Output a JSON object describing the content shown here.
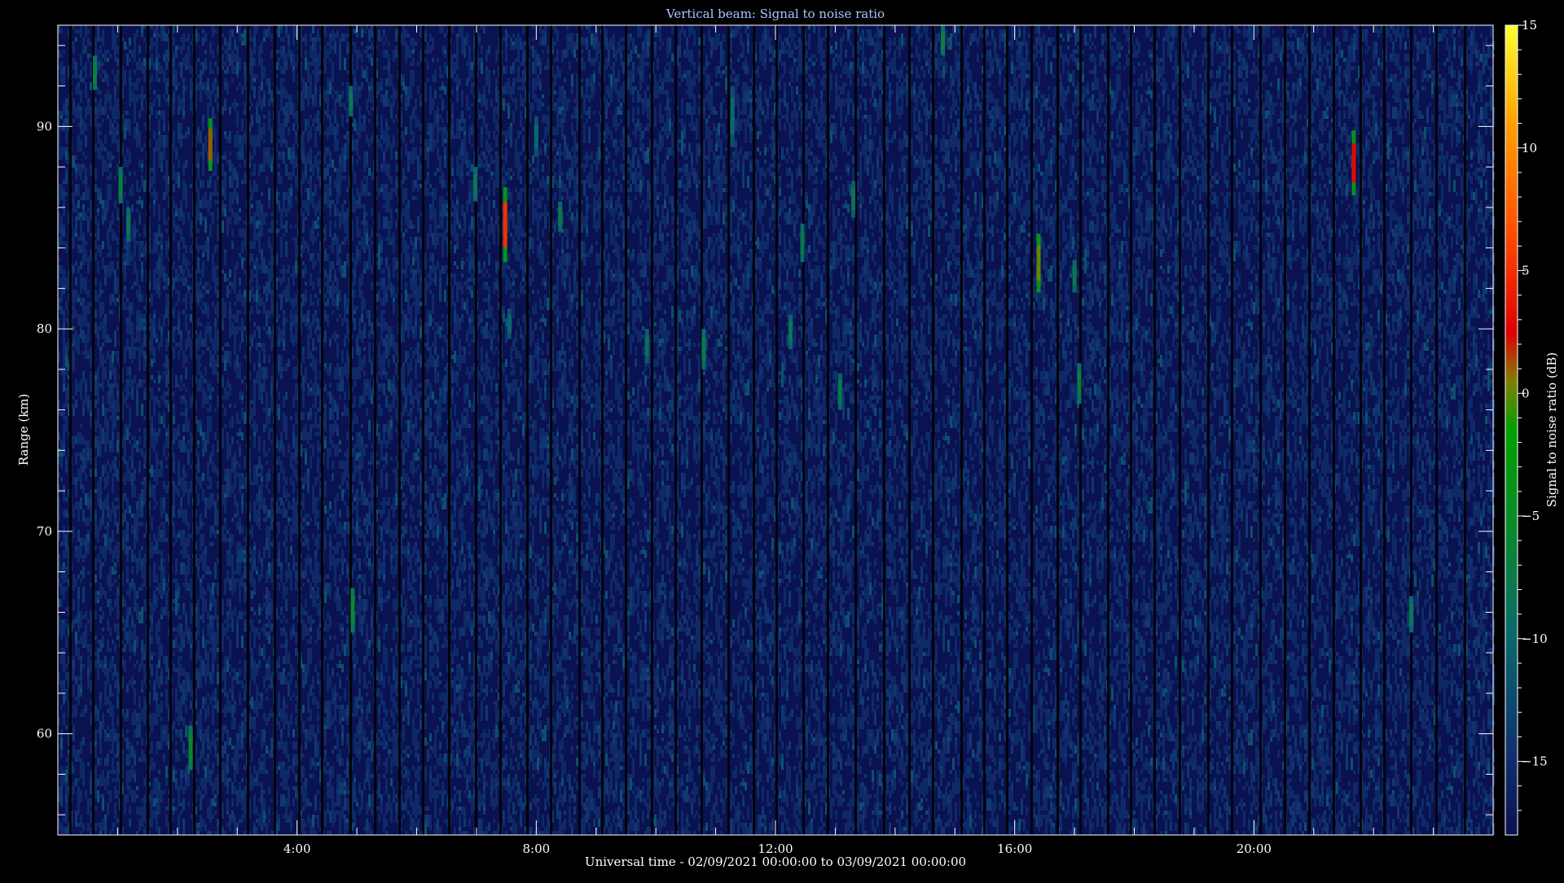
{
  "chart_data": {
    "type": "heatmap",
    "title": "Vertical beam: Signal to noise ratio",
    "xlabel": "Universal time - 02/09/2021 00:00:00 to 03/09/2021 00:00:00",
    "ylabel": "Range (km)",
    "colorbar_label": "Signal to noise ratio (dB)",
    "xlim": [
      0,
      24
    ],
    "ylim": [
      55,
      95
    ],
    "x_ticks": [
      {
        "value": 4,
        "label": "4:00"
      },
      {
        "value": 8,
        "label": "8:00"
      },
      {
        "value": 12,
        "label": "12:00"
      },
      {
        "value": 16,
        "label": "16:00"
      },
      {
        "value": 20,
        "label": "20:00"
      }
    ],
    "y_ticks": [
      {
        "value": 60,
        "label": "60"
      },
      {
        "value": 70,
        "label": "70"
      },
      {
        "value": 80,
        "label": "80"
      },
      {
        "value": 90,
        "label": "90"
      }
    ],
    "colorbar_range": [
      -18,
      15
    ],
    "colorbar_ticks": [
      {
        "value": 15,
        "label": "15"
      },
      {
        "value": 10,
        "label": "10"
      },
      {
        "value": 5,
        "label": "5"
      },
      {
        "value": 0,
        "label": "0"
      },
      {
        "value": -5,
        "label": "−5"
      },
      {
        "value": -10,
        "label": "−10"
      },
      {
        "value": -15,
        "label": "−15"
      }
    ],
    "background_level_db": -16,
    "colormap": [
      "#0a1250",
      "#103070",
      "#0a6a6a",
      "#0a8a2a",
      "#00a000",
      "#808000",
      "#dd0000",
      "#ff5000",
      "#ffa000",
      "#ffff30"
    ],
    "detections": [
      {
        "t": 0.62,
        "r0": 91.8,
        "r1": 93.5,
        "snr": -7
      },
      {
        "t": 1.05,
        "r0": 86.2,
        "r1": 88.0,
        "snr": -7
      },
      {
        "t": 1.18,
        "r0": 84.3,
        "r1": 86.0,
        "snr": -8
      },
      {
        "t": 2.22,
        "r0": 58.2,
        "r1": 60.4,
        "snr": -6
      },
      {
        "t": 2.55,
        "r0": 87.8,
        "r1": 90.4,
        "snr": 1
      },
      {
        "t": 4.9,
        "r0": 90.5,
        "r1": 92.0,
        "snr": -8
      },
      {
        "t": 4.93,
        "r0": 65.0,
        "r1": 67.2,
        "snr": -6
      },
      {
        "t": 6.98,
        "r0": 86.3,
        "r1": 88.0,
        "snr": -8
      },
      {
        "t": 7.48,
        "r0": 83.3,
        "r1": 87.0,
        "snr": 5
      },
      {
        "t": 7.55,
        "r0": 79.5,
        "r1": 81.0,
        "snr": -10
      },
      {
        "t": 8.0,
        "r0": 88.5,
        "r1": 90.5,
        "snr": -10
      },
      {
        "t": 8.4,
        "r0": 84.8,
        "r1": 86.3,
        "snr": -8
      },
      {
        "t": 9.85,
        "r0": 78.3,
        "r1": 80.0,
        "snr": -9
      },
      {
        "t": 10.8,
        "r0": 78.0,
        "r1": 80.0,
        "snr": -8
      },
      {
        "t": 11.28,
        "r0": 89.0,
        "r1": 92.0,
        "snr": -10
      },
      {
        "t": 12.25,
        "r0": 79.0,
        "r1": 80.7,
        "snr": -8
      },
      {
        "t": 12.45,
        "r0": 83.3,
        "r1": 85.2,
        "snr": -8
      },
      {
        "t": 13.08,
        "r0": 76.0,
        "r1": 77.8,
        "snr": -8
      },
      {
        "t": 13.3,
        "r0": 85.5,
        "r1": 87.3,
        "snr": -9
      },
      {
        "t": 14.8,
        "r0": 93.5,
        "r1": 95.0,
        "snr": -7
      },
      {
        "t": 16.4,
        "r0": 81.8,
        "r1": 84.7,
        "snr": 0
      },
      {
        "t": 17.0,
        "r0": 81.8,
        "r1": 83.4,
        "snr": -8
      },
      {
        "t": 17.08,
        "r0": 76.3,
        "r1": 78.3,
        "snr": -7
      },
      {
        "t": 21.67,
        "r0": 86.6,
        "r1": 89.8,
        "snr": 3
      },
      {
        "t": 22.63,
        "r0": 65.0,
        "r1": 66.8,
        "snr": -8
      }
    ]
  }
}
